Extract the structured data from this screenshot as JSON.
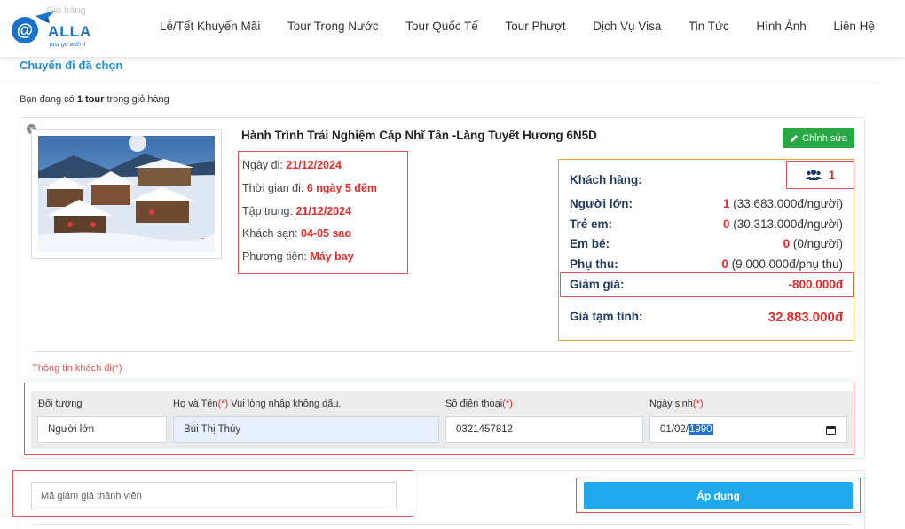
{
  "header": {
    "breadcrumb_ghost": "Giỏ hàng",
    "logo": {
      "text": "ALLA",
      "slogan": "just go with it"
    },
    "nav": [
      "Lễ/Tết Khuyến Mãi",
      "Tour Trong Nước",
      "Tour Quốc Tế",
      "Tour Phượt",
      "Dịch Vụ Visa",
      "Tin Tức",
      "Hình Ảnh",
      "Liên Hệ"
    ]
  },
  "page": {
    "title": "Chuyến đi đã chọn",
    "cart_note": {
      "prefix": "Bạn đang có ",
      "count": "1 tour",
      "suffix": " trong giỏ hàng"
    }
  },
  "tour": {
    "title": "Hành Trình Trải Nghiệm Cáp Nhĩ Tân -Làng Tuyết Hương 6N5D",
    "edit_label": "Chỉnh sửa",
    "details": [
      {
        "label": "Ngày đi: ",
        "value": "21/12/2024"
      },
      {
        "label": "Thời gian đi: ",
        "value": "6 ngày 5 đêm"
      },
      {
        "label": "Tập trung: ",
        "value": "21/12/2024"
      },
      {
        "label": "Khách sạn: ",
        "value": "04-05 sao"
      },
      {
        "label": "Phương tiện: ",
        "value": "Máy bay"
      }
    ]
  },
  "pricing": {
    "customer_label": "Khách hàng:",
    "customer_count": "1",
    "rows": [
      {
        "label": "Người lớn:",
        "count": "1",
        "unit": "(33.683.000đ/người)"
      },
      {
        "label": "Trẻ em:",
        "count": "0",
        "unit": "(30.313.000đ/người)"
      },
      {
        "label": "Em bé:",
        "count": "0",
        "unit": "(0/người)"
      },
      {
        "label": "Phụ thu:",
        "count": "0",
        "unit": "(9.000.000đ/phụ thu)"
      }
    ],
    "discount_label": "Giảm giá:",
    "discount_value": "-800.000đ",
    "total_label": "Giá tạm tính:",
    "total_value": "32.883.000đ"
  },
  "guest_form": {
    "section_label": "Thông tin khách đi(*)",
    "fields": {
      "type_label": "Đối tượng",
      "type_value": "Người lớn",
      "name_label": "Họ và Tên",
      "name_hint": " Vui lòng nhập không dấu.",
      "name_value": "Bùi Thị Thúy",
      "phone_label": "Số điện thoại",
      "phone_value": "0321457812",
      "dob_label": "Ngày sinh",
      "dob_prefix": "01/02/",
      "dob_year": "1990",
      "required_mark": "(*)"
    }
  },
  "coupon": {
    "placeholder": "Mã giảm giá thành viên",
    "apply_label": "Áp dụng"
  },
  "colors": {
    "accent_blue": "#1fa8ec",
    "title_blue": "#1f8fd6",
    "price_red": "#e32b2b",
    "edit_green": "#28a745",
    "highlight_red": "#e05555",
    "box_orange": "#e8a23a"
  }
}
